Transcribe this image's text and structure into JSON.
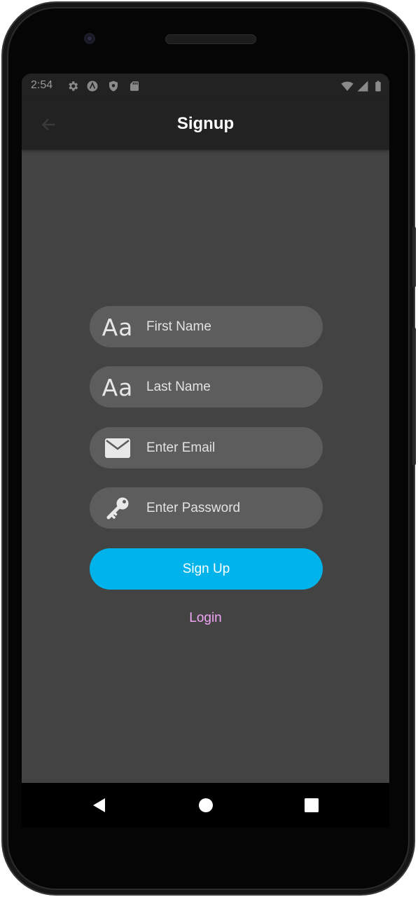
{
  "status_bar": {
    "time": "2:54",
    "icons": [
      "gear-icon",
      "a-circle-icon",
      "shield-icon",
      "sd-card-icon",
      "wifi-icon",
      "signal-icon",
      "battery-icon"
    ]
  },
  "app_bar": {
    "title": "Signup",
    "back_icon": "back-arrow-icon"
  },
  "form": {
    "fields": [
      {
        "placeholder": "First Name",
        "value": "",
        "icon": "text-aa-icon"
      },
      {
        "placeholder": "Last Name",
        "value": "",
        "icon": "text-aa-icon"
      },
      {
        "placeholder": "Enter Email",
        "value": "",
        "icon": "envelope-icon"
      },
      {
        "placeholder": "Enter Password",
        "value": "",
        "icon": "key-icon"
      }
    ],
    "icon_glyph": "Aa",
    "submit_label": "Sign Up",
    "login_label": "Login"
  },
  "nav_bar": {
    "icons": [
      "back-triangle-icon",
      "home-circle-icon",
      "recents-square-icon"
    ]
  },
  "colors": {
    "background": "#434343",
    "app_bar": "#222222",
    "field": "#5d5d5d",
    "accent": "#00b4eb",
    "link": "#f1a6f5"
  }
}
